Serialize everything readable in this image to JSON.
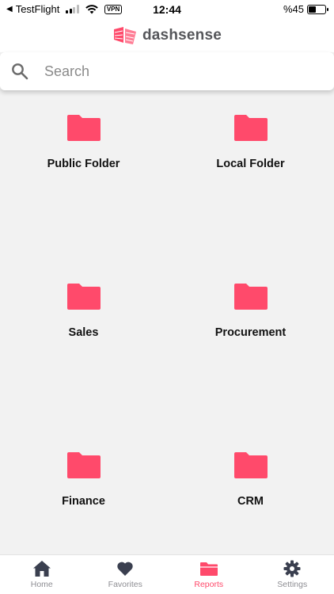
{
  "status_bar": {
    "back_app": "TestFlight",
    "vpn": "VPN",
    "time": "12:44",
    "battery_text": "%45",
    "battery_level": 0.45
  },
  "header": {
    "brand": "dashsense",
    "logo_icon": "dashsense-logo-icon",
    "brand_color": "#ff4a6b"
  },
  "search": {
    "placeholder": "Search",
    "value": ""
  },
  "folders": [
    {
      "label": "Public Folder",
      "icon": "folder-icon"
    },
    {
      "label": "Local Folder",
      "icon": "folder-icon"
    },
    {
      "label": "Sales",
      "icon": "folder-icon"
    },
    {
      "label": "Procurement",
      "icon": "folder-icon"
    },
    {
      "label": "Finance",
      "icon": "folder-icon"
    },
    {
      "label": "CRM",
      "icon": "folder-icon"
    }
  ],
  "tabs": [
    {
      "label": "Home",
      "icon": "home-icon",
      "active": false
    },
    {
      "label": "Favorites",
      "icon": "heart-icon",
      "active": false
    },
    {
      "label": "Reports",
      "icon": "folder-icon",
      "active": true
    },
    {
      "label": "Settings",
      "icon": "gear-icon",
      "active": false
    }
  ],
  "colors": {
    "accent": "#ff4a6b",
    "background": "#f2f2f2",
    "tab_inactive": "#8e8e93",
    "tab_icon_inactive": "#3a3f4f"
  }
}
